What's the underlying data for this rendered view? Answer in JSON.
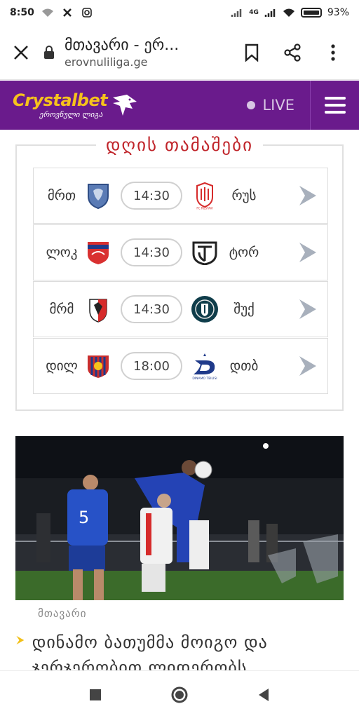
{
  "status_bar": {
    "time": "8:50",
    "network": "4G",
    "battery": "93%"
  },
  "browser": {
    "title": "მთავარი - ერ...",
    "domain": "erovnuliliga.ge"
  },
  "header": {
    "brand": "Crystalbet",
    "league": "ეროვნული ლიგა",
    "live_label": "LIVE",
    "brand_color": "#6a1b8c",
    "logo_color": "#f6c21c"
  },
  "games": {
    "title": "დღის თამაშები",
    "matches": [
      {
        "home": "მრთ",
        "time": "14:30",
        "away": "რუს",
        "home_badge": "lion-badge-icon",
        "away_badge": "rustavi-badge-icon"
      },
      {
        "home": "ლოკ",
        "time": "14:30",
        "away": "ტორ",
        "home_badge": "locomotive-badge-icon",
        "away_badge": "torpedo-badge-icon"
      },
      {
        "home": "მრმ",
        "time": "14:30",
        "away": "შუქ",
        "home_badge": "merani-badge-icon",
        "away_badge": "shukura-badge-icon"
      },
      {
        "home": "დილ",
        "time": "18:00",
        "away": "დთბ",
        "home_badge": "dila-badge-icon",
        "away_badge": "dinamo-tbilisi-badge-icon"
      }
    ]
  },
  "news": {
    "category": "მთავარი",
    "headline": "დინამო ბათუმმა მოიგო და ჯერჯერობით ლიდერობს"
  }
}
